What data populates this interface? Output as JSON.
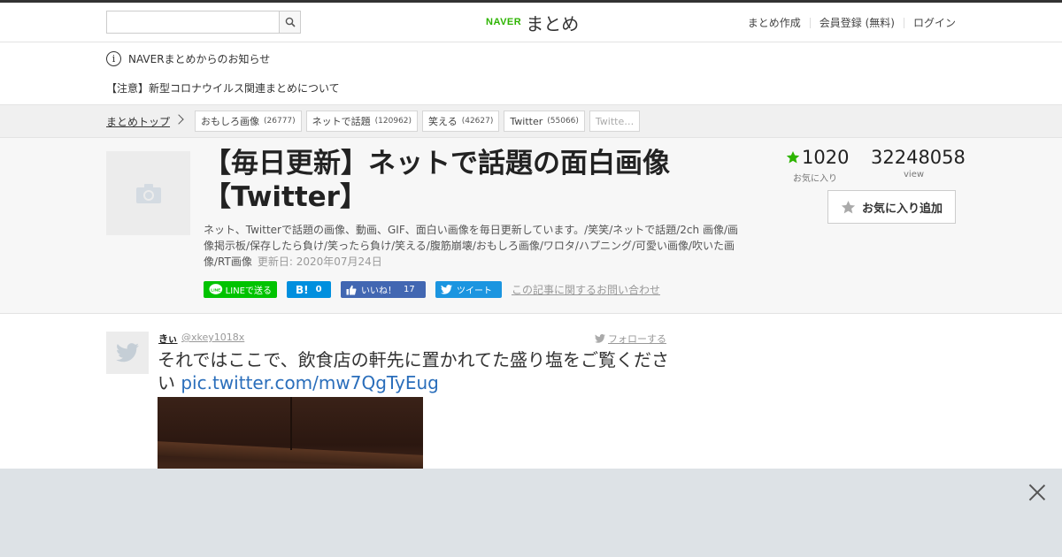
{
  "header": {
    "search_placeholder": "",
    "logo_naver": "NAVER",
    "logo_matome": "まとめ",
    "links": [
      "まとめ作成",
      "会員登録 (無料)",
      "ログイン"
    ]
  },
  "notice": {
    "icon_glyph": "i",
    "title": "NAVERまとめからのお知らせ",
    "link": "【注意】新型コロナウイルス関連まとめについて"
  },
  "breadcrumb": {
    "top": "まとめトップ",
    "tags": [
      {
        "label": "おもしろ画像",
        "count": "(26777)"
      },
      {
        "label": "ネットで話題",
        "count": "(120962)"
      },
      {
        "label": "笑える",
        "count": "(42627)"
      },
      {
        "label": "Twitter",
        "count": "(55066)"
      },
      {
        "label": "Twitte…",
        "count": ""
      }
    ]
  },
  "summary": {
    "title": "【毎日更新】ネットで話題の面白画像【Twitter】",
    "description": "ネット、Twitterで話題の画像、動画、GIF、面白い画像を毎日更新しています。/笑笑/ネットで話題/2ch 画像/画像掲示板/保存したら負け/笑ったら負け/笑える/腹筋崩壊/おもしろ画像/ワロタ/ハプニング/可愛い画像/吹いた画像/RT画像",
    "updated": "更新日: 2020年07月24日",
    "fav_count": "1020",
    "fav_label": "お気に入り",
    "view_count": "32248058",
    "view_label": "view",
    "fav_button": "お気に入り追加",
    "share": {
      "line": "LINEで送る",
      "hatena_logo": "B!",
      "hatena_count": "0",
      "fb": "いいね！",
      "fb_count": "17",
      "tw": "ツイート",
      "inquiry": "この記事に関するお問い合わせ"
    }
  },
  "tweet": {
    "name": "きぃ",
    "handle": "@xkey1018x",
    "follow": "フォローする",
    "text": "それではここで、飲食店の軒先に置かれてた盛り塩をご覧ください ",
    "link": "pic.twitter.com/mw7QgTyEug"
  },
  "colors": {
    "accent_green": "#2db400",
    "line_green": "#00c300",
    "hatena_blue": "#008fde",
    "fb_blue": "#4267b2",
    "tw_blue": "#1b95e0",
    "link_blue": "#2a6ebb"
  }
}
